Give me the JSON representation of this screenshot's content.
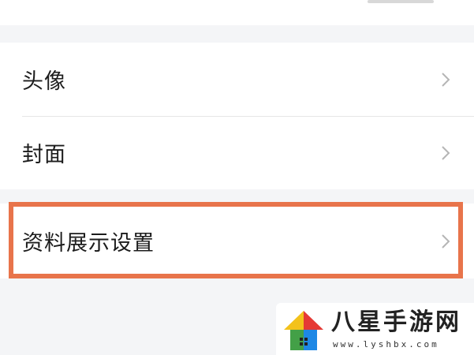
{
  "settings": {
    "items": [
      {
        "label": "头像"
      },
      {
        "label": "封面"
      }
    ],
    "profile_display": {
      "label": "资料展示设置"
    }
  },
  "highlight_color": "#e8744b",
  "watermark": {
    "title": "八星手游网",
    "url": "www.lyshbx.com"
  },
  "icons": {
    "row_arrow": "chevron-right-icon"
  }
}
